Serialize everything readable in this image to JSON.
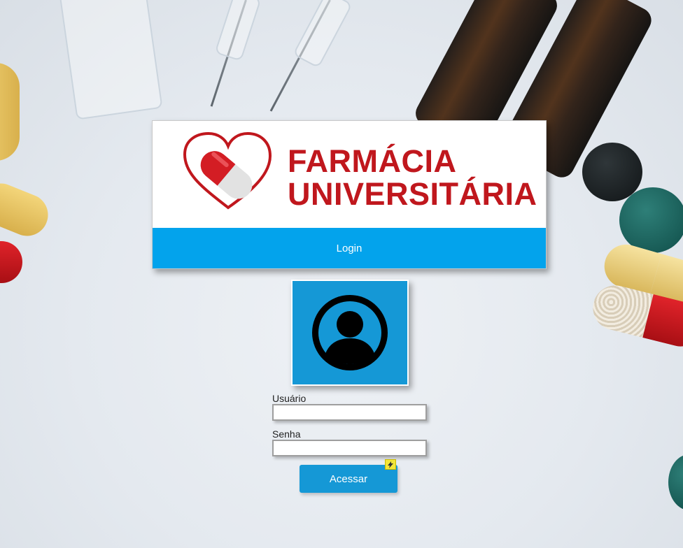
{
  "header": {
    "logo": {
      "line1": "FARMÁCIA",
      "line2": "UNIVERSITÁRIA",
      "icon": "heart-capsule-logo"
    },
    "login_title": "Login"
  },
  "avatar": {
    "icon": "user-avatar-icon"
  },
  "form": {
    "username_label": "Usuário",
    "username_value": "",
    "password_label": "Senha",
    "password_value": "",
    "submit_label": "Acessar",
    "badge_icon": "lightning-icon"
  },
  "colors": {
    "brand_red": "#c0171d",
    "login_bar": "#03a3ec",
    "button_blue": "#1598d6",
    "background": "#e4e9ef"
  }
}
